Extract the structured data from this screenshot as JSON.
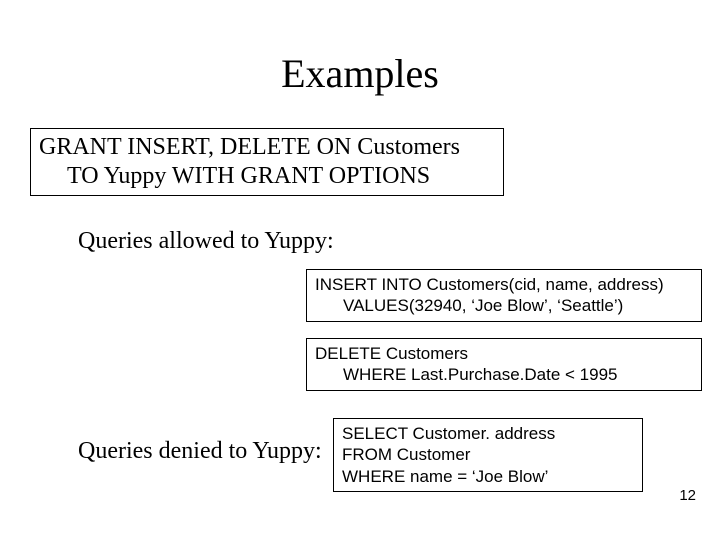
{
  "title": "Examples",
  "grant": {
    "line1": "GRANT INSERT, DELETE ON Customers",
    "line2": "TO Yuppy WITH GRANT OPTIONS"
  },
  "allowed_label": "Queries allowed to Yuppy:",
  "insert_query": {
    "line1": "INSERT INTO Customers(cid, name, address)",
    "line2": "VALUES(32940, ‘Joe Blow’, ‘Seattle’)"
  },
  "delete_query": {
    "line1": "DELETE Customers",
    "line2": "WHERE Last.Purchase.Date < 1995"
  },
  "denied_label": "Queries denied to Yuppy:",
  "select_query": {
    "line1": "SELECT Customer. address",
    "line2": "FROM Customer",
    "line3": "WHERE name = ‘Joe Blow’"
  },
  "page_number": "12"
}
